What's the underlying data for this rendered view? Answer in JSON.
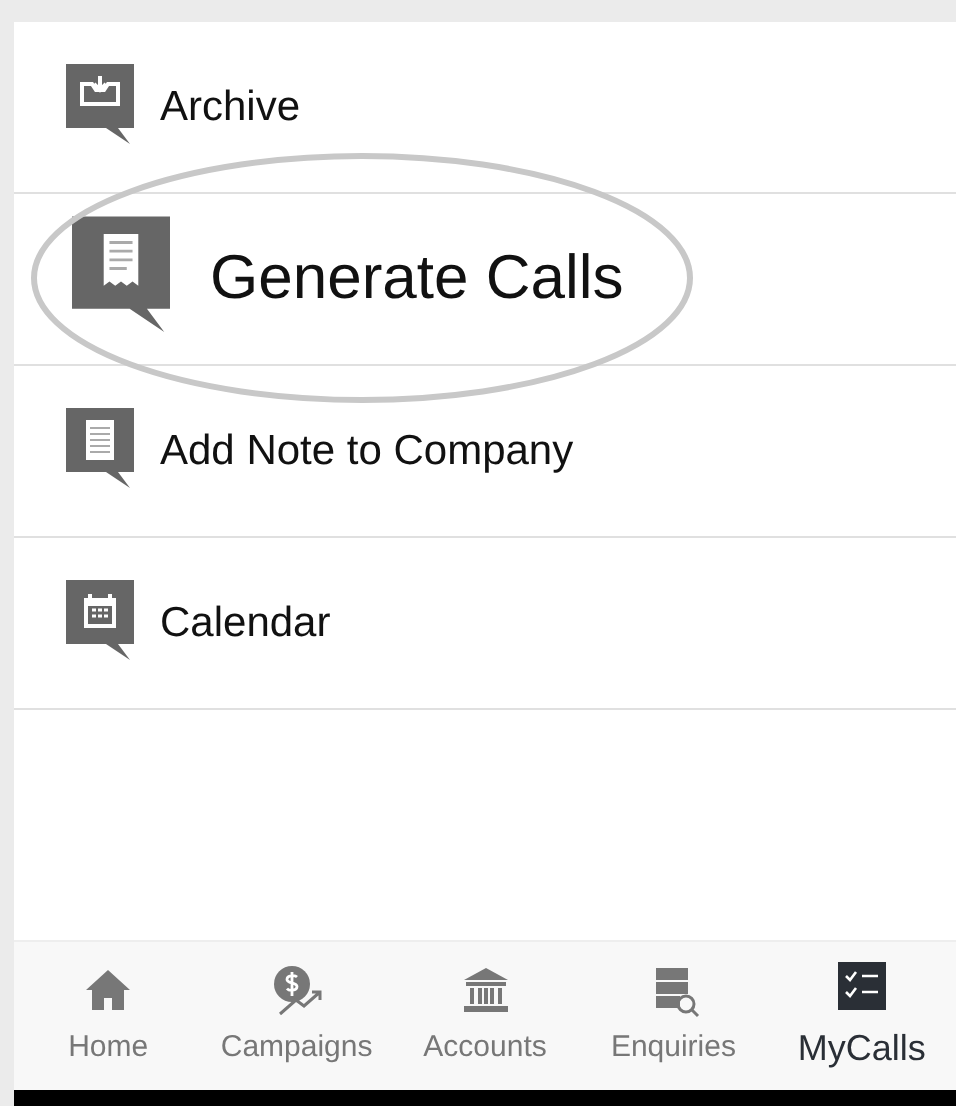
{
  "menu": [
    {
      "label": "Archive",
      "kind": "archive",
      "highlighted": false
    },
    {
      "label": "Generate Calls",
      "kind": "receipt",
      "highlighted": true
    },
    {
      "label": "Add Note to Company",
      "kind": "note",
      "highlighted": false
    },
    {
      "label": "Calendar",
      "kind": "calendar",
      "highlighted": false
    }
  ],
  "bottom_nav": [
    {
      "label": "Home",
      "kind": "home",
      "selected": false
    },
    {
      "label": "Campaigns",
      "kind": "campaign",
      "selected": false
    },
    {
      "label": "Accounts",
      "kind": "bank",
      "selected": false
    },
    {
      "label": "Enquiries",
      "kind": "enquiry",
      "selected": false
    },
    {
      "label": "MyCalls",
      "kind": "checklist",
      "selected": true
    }
  ]
}
